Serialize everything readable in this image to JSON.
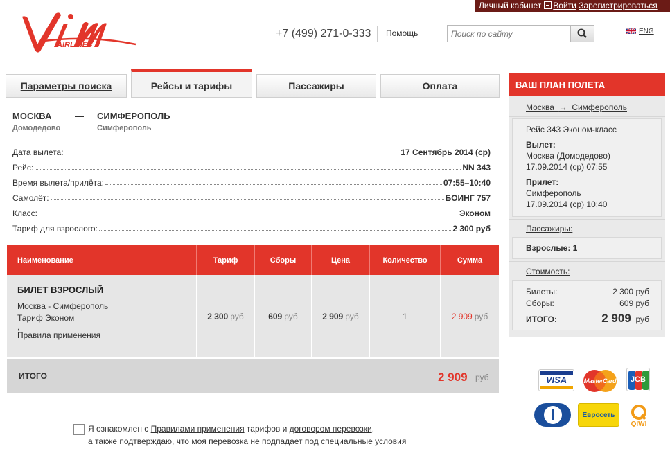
{
  "top_bar": {
    "cabinet_label": "Личный кабинет",
    "login_label": "Войти",
    "register_label": "Зарегистрироваться"
  },
  "header": {
    "logo_text": "AIRLINES",
    "phone": "+7 (499) 271-0-333",
    "help_label": "Помощь",
    "search_placeholder": "Поиск по сайту",
    "lang_label": "ENG"
  },
  "tabs": [
    {
      "label": "Параметры поиска"
    },
    {
      "label": "Рейсы и тарифы"
    },
    {
      "label": "Пассажиры"
    },
    {
      "label": "Оплата"
    }
  ],
  "route": {
    "from_city": "МОСКВА",
    "from_airport": "Домодедово",
    "dash": "—",
    "to_city": "СИМФЕРОПОЛЬ",
    "to_airport": "Симферополь"
  },
  "details": [
    {
      "label": "Дата вылета:",
      "value": "17 Сентябрь 2014 (ср)"
    },
    {
      "label": "Рейс:",
      "value": "NN 343"
    },
    {
      "label": "Время вылета/прилёта:",
      "value": "07:55–10:40"
    },
    {
      "label": "Самолёт:",
      "value": "БОИНГ 757"
    },
    {
      "label": "Класс:",
      "value": "Эконом"
    },
    {
      "label": "Тариф для взрослого:",
      "value": "2 300 руб"
    }
  ],
  "table": {
    "headers": [
      "Наименование",
      "Тариф",
      "Сборы",
      "Цена",
      "Количество",
      "Сумма"
    ],
    "row": {
      "title": "БИЛЕТ ВЗРОСЛЫЙ",
      "route": "Москва - Симферополь",
      "fare": "Тариф Эконом",
      "comma": ",",
      "rules_link": "Правила применения",
      "tariff": "2 300",
      "fees": "609",
      "price": "2 909",
      "quantity": "1",
      "sum": "2 909",
      "currency": "руб"
    },
    "total_label": "ИТОГО",
    "total_value": "2 909",
    "total_currency": "руб"
  },
  "agreement": {
    "text1": "Я ознакомлен с ",
    "link1": "Правилами применения",
    "text2": " тарифов и ",
    "link2": "договором перевозки",
    "text3": ",",
    "text4": "а также подтверждаю, что моя перевозка не подпадает под ",
    "link3": "специальные условия"
  },
  "sidebar": {
    "title": "ВАШ ПЛАН ПОЛЕТА",
    "route_from": "Москва",
    "route_arrow": "→",
    "route_to": "Симферополь",
    "flight_line": "Рейс  343  Эконом-класс",
    "departure_label": "Вылет:",
    "departure_place": "Москва  (Домодедово)",
    "departure_time": "17.09.2014 (ср) 07:55",
    "arrival_label": "Прилет:",
    "arrival_place": "Симферополь",
    "arrival_time": "17.09.2014 (ср) 10:40",
    "passengers_link": "Пассажиры:",
    "adults": "Взрослые: 1",
    "cost_link": "Стоимость:",
    "tickets_label": "Билеты:",
    "tickets_value": "2 300 руб",
    "fees_label": "Сборы:",
    "fees_value": "609 руб",
    "total_label": "ИТОГО:",
    "total_value": "2 909",
    "total_currency": "руб"
  },
  "payment": {
    "visa": "VISA",
    "mastercard": "MasterCard",
    "jcb": "JCB",
    "evroset": "Евросеть",
    "qiwi": "QIWI"
  },
  "colors": {
    "accent": "#e2352a",
    "account_bar": "#6b1b16"
  }
}
